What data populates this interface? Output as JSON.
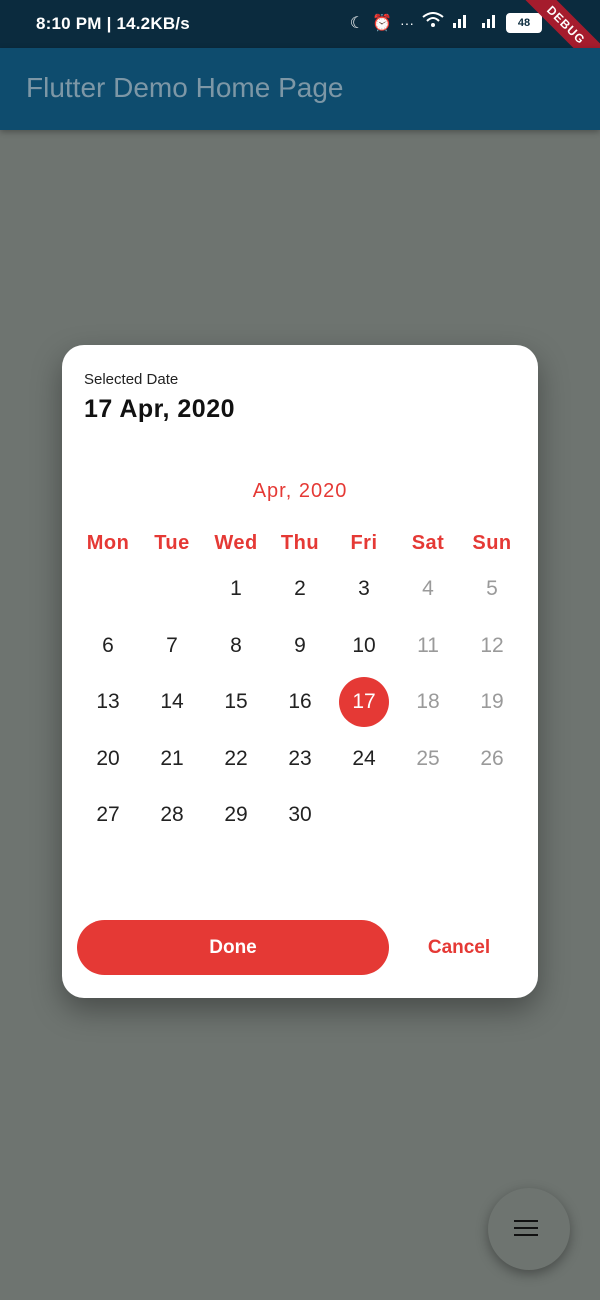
{
  "status_bar": {
    "text": "8:10 PM | 14.2KB/s",
    "icons": [
      "moon-icon",
      "alarm-icon",
      "more-dots-icon",
      "wifi-icon",
      "signal-icon",
      "signal-4g-icon",
      "battery-icon"
    ],
    "battery_level": "48",
    "debug_banner": "DEBUG"
  },
  "app_bar": {
    "title": "Flutter Demo Home Page"
  },
  "dialog": {
    "selected_label": "Selected Date",
    "selected_value": "17 Apr, 2020",
    "month_title": "Apr, 2020",
    "weekdays": [
      "Mon",
      "Tue",
      "Wed",
      "Thu",
      "Fri",
      "Sat",
      "Sun"
    ],
    "weeks": [
      [
        "",
        "",
        "1",
        "2",
        "3",
        "4",
        "5"
      ],
      [
        "6",
        "7",
        "8",
        "9",
        "10",
        "11",
        "12"
      ],
      [
        "13",
        "14",
        "15",
        "16",
        "17",
        "18",
        "19"
      ],
      [
        "20",
        "21",
        "22",
        "23",
        "24",
        "25",
        "26"
      ],
      [
        "27",
        "28",
        "29",
        "30",
        "",
        "",
        ""
      ]
    ],
    "selected_day": "17",
    "done_label": "Done",
    "cancel_label": "Cancel"
  },
  "fab": {
    "icon": "menu-icon"
  },
  "colors": {
    "accent": "#e53935",
    "app_bar": "#0e4c6e",
    "status_bar": "#0b2b3e",
    "scrim": "#6e7470"
  }
}
